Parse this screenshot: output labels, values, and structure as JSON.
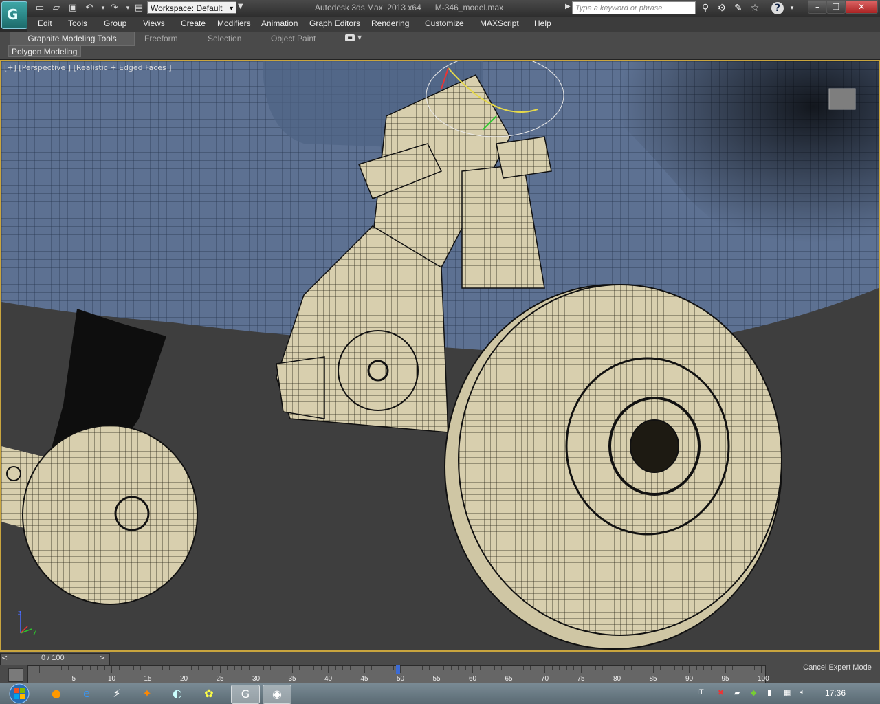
{
  "title_bar": {
    "workspace_label": "Workspace: Default",
    "title": "Autodesk 3ds Max  2013 x64      M-346_model.max",
    "search_placeholder": "Type a keyword or phrase",
    "help_label": "?",
    "minimize": "–",
    "maximize": "❐",
    "close": "✕"
  },
  "menu": [
    "Edit",
    "Tools",
    "Group",
    "Views",
    "Create",
    "Modifiers",
    "Animation",
    "Graph Editors",
    "Rendering",
    "Customize",
    "MAXScript",
    "Help"
  ],
  "ribbon": {
    "tabs": [
      "Graphite Modeling Tools",
      "Freeform",
      "Selection",
      "Object Paint"
    ],
    "active_tab": "Graphite Modeling Tools",
    "panel": "Polygon Modeling"
  },
  "viewport": {
    "label": "[+] [Perspective ] [Realistic + Edged Faces ]",
    "axis_z": "z",
    "axis_y": "y"
  },
  "timeline": {
    "slider_text": "0 / 100",
    "prev": "<",
    "next": ">",
    "tick_labels": [
      "5",
      "10",
      "15",
      "20",
      "25",
      "30",
      "35",
      "40",
      "45",
      "50",
      "55",
      "60",
      "65",
      "70",
      "75",
      "80",
      "85",
      "90",
      "95",
      "100"
    ],
    "cancel_expert_mode": "Cancel Expert Mode",
    "current_frame": "53"
  },
  "taskbar": {
    "language": "IT",
    "time": "17:36"
  },
  "colors": {
    "viewport_border": "#c9a53e",
    "mesh": "#d8cfae",
    "fuselage": "#6b7f9e"
  }
}
